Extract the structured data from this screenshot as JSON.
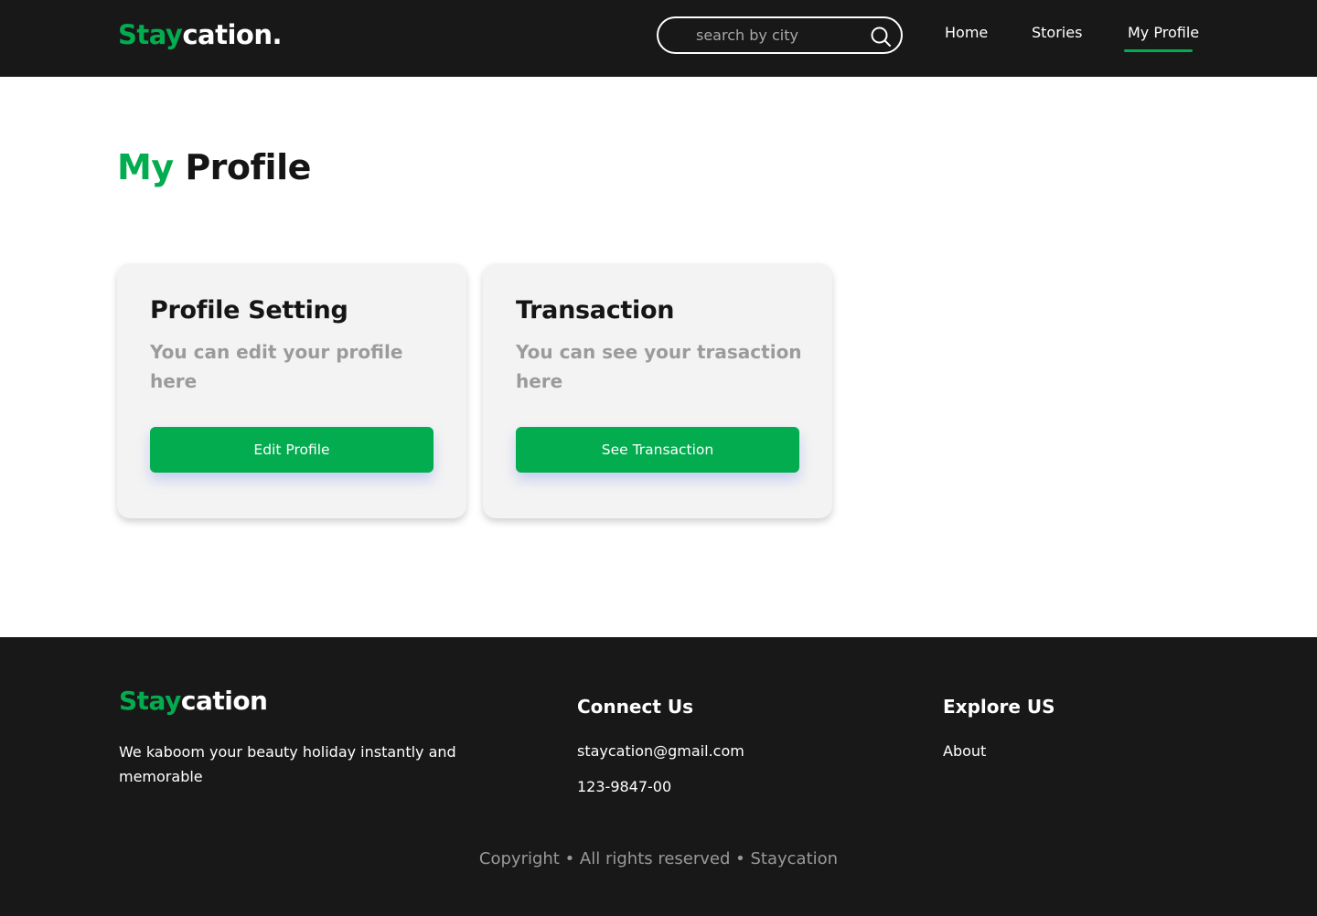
{
  "header": {
    "logo_accent": "Stay",
    "logo_rest": "cation.",
    "search_placeholder": "search by city",
    "nav": {
      "home": "Home",
      "stories": "Stories",
      "profile": "My Profile"
    },
    "active_nav": "My Profile"
  },
  "main": {
    "title_accent": "My",
    "title_rest": " Profile",
    "cards": [
      {
        "title": "Profile Setting",
        "description": "You can edit your profile here",
        "button": "Edit Profile"
      },
      {
        "title": "Transaction",
        "description": "You can see your trasaction here",
        "button": "See Transaction"
      }
    ]
  },
  "footer": {
    "logo_accent": "Stay",
    "logo_rest": "cation",
    "tagline": "We kaboom your beauty holiday instantly and memorable",
    "connect_heading": "Connect Us",
    "email": "staycation@gmail.com",
    "phone": "123-9847-00",
    "explore_heading": "Explore  US",
    "about": "About",
    "copyright": "Copyright • All rights reserved • Staycation"
  },
  "colors": {
    "accent": "#03AC4F",
    "dark": "#181818",
    "card_bg": "#F3F3F3",
    "muted_text": "#9B9B9B"
  },
  "icons": [
    "search-icon"
  ]
}
